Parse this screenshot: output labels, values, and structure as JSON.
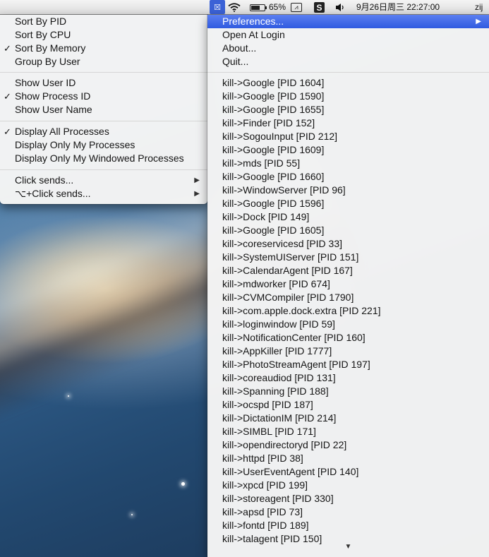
{
  "menubar": {
    "app_icon": "app-menu-icon",
    "wifi_icon": "wifi-icon",
    "battery_percent": "65%",
    "battery_level": 0.65,
    "status_icon": "activity-icon",
    "s_icon": "S",
    "volume_icon": "volume-icon",
    "datetime": "9月26日周三  22:27:00",
    "user": "zij"
  },
  "left_menu": {
    "items": [
      {
        "label": "Sort By PID",
        "checked": false
      },
      {
        "label": "Sort By CPU",
        "checked": false
      },
      {
        "label": "Sort By Memory",
        "checked": true
      },
      {
        "label": "Group By User",
        "checked": false
      },
      {
        "label": "Show User ID",
        "checked": false
      },
      {
        "label": "Show Process ID",
        "checked": true
      },
      {
        "label": "Show User Name",
        "checked": false
      },
      {
        "label": "Display All Processes",
        "checked": true
      },
      {
        "label": "Display Only My Processes",
        "checked": false
      },
      {
        "label": "Display Only My Windowed Processes",
        "checked": false
      },
      {
        "label": "Click sends...",
        "submenu": true
      },
      {
        "label": "⌥+Click sends...",
        "submenu": true
      }
    ],
    "check_glyph": "✓",
    "submenu_glyph": "▶"
  },
  "right_menu": {
    "top_items": [
      {
        "label": "Preferences...",
        "submenu": true,
        "highlighted": true
      },
      {
        "label": "Open At Login"
      },
      {
        "label": "About..."
      },
      {
        "label": "Quit..."
      }
    ],
    "processes": [
      "kill->Google [PID 1604]",
      "kill->Google [PID 1590]",
      "kill->Google [PID 1655]",
      "kill->Finder [PID 152]",
      "kill->SogouInput [PID 212]",
      "kill->Google [PID 1609]",
      "kill->mds [PID 55]",
      "kill->Google [PID 1660]",
      "kill->WindowServer [PID 96]",
      "kill->Google [PID 1596]",
      "kill->Dock [PID 149]",
      "kill->Google [PID 1605]",
      "kill->coreservicesd [PID 33]",
      "kill->SystemUIServer [PID 151]",
      "kill->CalendarAgent [PID 167]",
      "kill->mdworker [PID 674]",
      "kill->CVMCompiler [PID 1790]",
      "kill->com.apple.dock.extra [PID 221]",
      "kill->loginwindow [PID 59]",
      "kill->NotificationCenter [PID 160]",
      "kill->AppKiller [PID 1777]",
      "kill->PhotoStreamAgent [PID 197]",
      "kill->coreaudiod [PID 131]",
      "kill->Spanning [PID 188]",
      "kill->ocspd [PID 187]",
      "kill->DictationIM [PID 214]",
      "kill->SIMBL [PID 171]",
      "kill->opendirectoryd [PID 22]",
      "kill->httpd [PID 38]",
      "kill->UserEventAgent [PID 140]",
      "kill->xpcd [PID 199]",
      "kill->storeagent [PID 330]",
      "kill->apsd [PID 73]",
      "kill->fontd [PID 189]",
      "kill->talagent [PID 150]"
    ],
    "scroll_glyph": "▼"
  },
  "colors": {
    "highlight": "#3a63e4",
    "menu_bg": "#f4f4f4"
  }
}
